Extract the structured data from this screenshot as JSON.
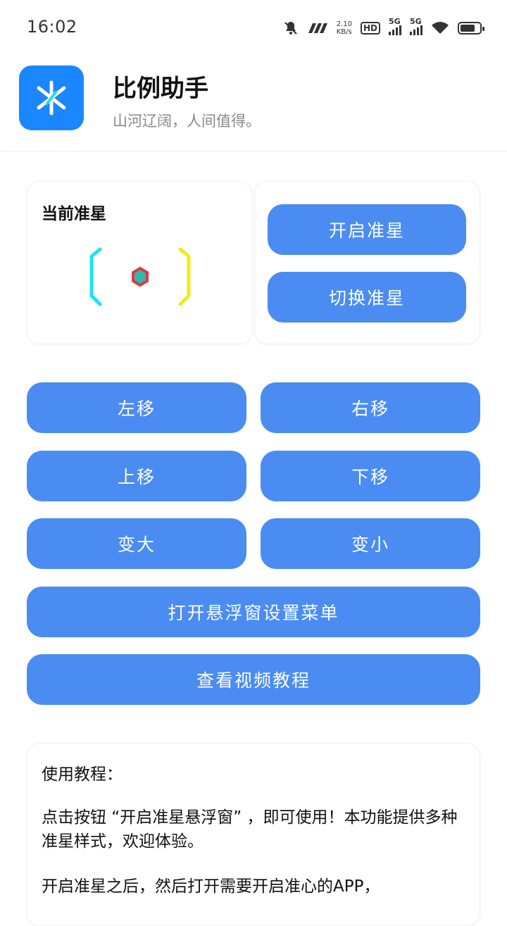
{
  "status_bar": {
    "time": "16:02",
    "net_speed_value": "2.10",
    "net_speed_unit": "KB/s",
    "hd_label": "HD",
    "signal_labels": [
      "5G",
      "5G"
    ],
    "icons": [
      "mute-icon",
      "volte-icon",
      "hd-icon",
      "signal-icon",
      "wifi-icon",
      "battery-icon"
    ]
  },
  "header": {
    "title": "比例助手",
    "subtitle": "山河辽阔，人间值得。",
    "logo_color": "#1a86ff"
  },
  "crosshair_card": {
    "title": "当前准星"
  },
  "actions": {
    "open_label": "开启准星",
    "switch_label": "切换准星"
  },
  "controls": {
    "left_label": "左移",
    "right_label": "右移",
    "up_label": "上移",
    "down_label": "下移",
    "bigger_label": "变大",
    "smaller_label": "变小",
    "float_menu_label": "打开悬浮窗设置菜单",
    "video_label": "查看视频教程"
  },
  "tutorial": {
    "title": "使用教程：",
    "paragraph1": "点击按钮 “开启准星悬浮窗” ，即可使用！本功能提供多种准星样式，欢迎体验。",
    "paragraph2": "开启准星之后，然后打开需要开启准心的APP，"
  },
  "colors": {
    "button": "#4a8cf2",
    "accent_cyan": "#19e6f0",
    "accent_yellow": "#f2ea1a",
    "center_red": "#e03a3a",
    "center_teal": "#2fb9b0"
  }
}
